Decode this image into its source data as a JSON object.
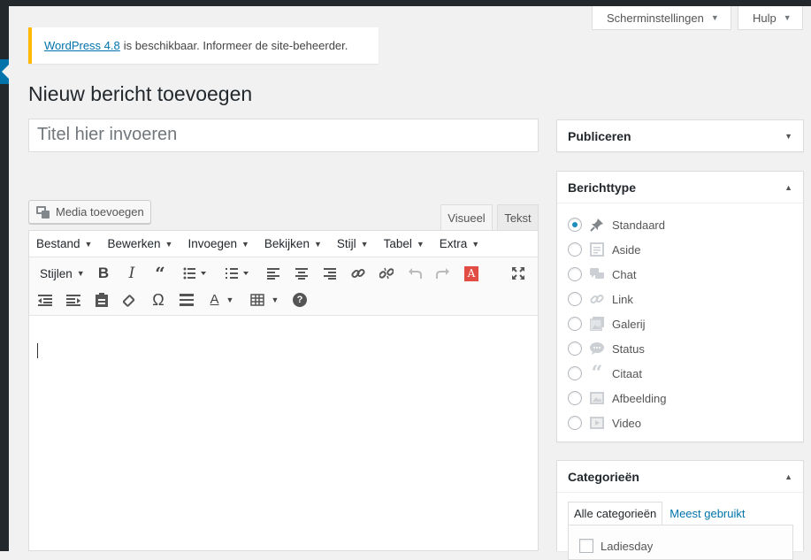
{
  "header": {
    "screen_options": "Scherminstellingen",
    "help": "Hulp"
  },
  "notice": {
    "link": "WordPress 4.8",
    "text": "is beschikbaar. Informeer de site-beheerder."
  },
  "page": {
    "title": "Nieuw bericht toevoegen",
    "title_placeholder": "Titel hier invoeren"
  },
  "editor": {
    "media_button": "Media toevoegen",
    "tab_visual": "Visueel",
    "tab_text": "Tekst",
    "menu": [
      "Bestand",
      "Bewerken",
      "Invoegen",
      "Bekijken",
      "Stijl",
      "Tabel",
      "Extra"
    ],
    "styles_label": "Stijlen",
    "bold": "B",
    "italic": "I",
    "quote": "“",
    "text_color": "A",
    "red_a": "A",
    "omega": "Ω",
    "help": "?"
  },
  "sidebar": {
    "publish": {
      "title": "Publiceren"
    },
    "format": {
      "title": "Berichttype",
      "selected": "Standaard",
      "options": [
        "Standaard",
        "Aside",
        "Chat",
        "Link",
        "Galerij",
        "Status",
        "Citaat",
        "Afbeelding",
        "Video"
      ]
    },
    "categories": {
      "title": "Categorieën",
      "tab_all": "Alle categorieën",
      "tab_popular": "Meest gebruikt",
      "items": [
        "Ladiesday"
      ]
    }
  },
  "colors": {
    "admin_bar": "#23282d",
    "accent": "#0073aa",
    "notice_border": "#ffb900",
    "red_button": "#e14d43"
  }
}
